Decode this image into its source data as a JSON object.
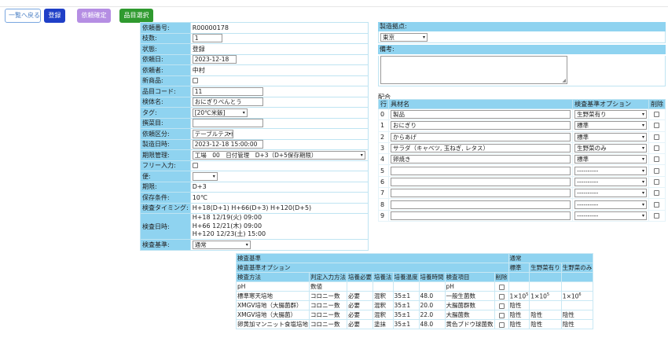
{
  "toolbar": {
    "back_label": "一覧へ戻る",
    "register_label": "登録",
    "confirm_label": "依頼確定",
    "select_label": "品目選択"
  },
  "form": {
    "request_no_label": "依頼番号:",
    "request_no": "R00000178",
    "count_label": "枝数:",
    "count": "1",
    "status_label": "状態:",
    "status": "登録",
    "request_date_label": "依頼日:",
    "request_date": "2023-12-18",
    "requester_label": "依頼者:",
    "requester": "中村",
    "new_product_label": "新商品:",
    "item_code_label": "品目コード:",
    "item_code": "11",
    "sample_name_label": "検体名:",
    "sample_name": "おにぎりべんとう",
    "tag_label": "タグ:",
    "tag": "[20℃米飯]",
    "note_label": "撰菜目:",
    "category_label": "依頼区分:",
    "category": "テーブルテスト",
    "mfg_datetime_label": "製造日時:",
    "mfg_datetime": "2023-12-18 15:00:00",
    "deadline_label": "期限管理:",
    "deadline": "工場　00　日付管理　D+3（D+5保存期限）",
    "free_input_label": "フリー入力:",
    "convenience_label": "便:",
    "period_label": "期限:",
    "period": "D+3",
    "storage_label": "保存条件:",
    "storage": "10℃",
    "timing_label": "検査タイミング:",
    "timing": "H+18(D+1) H+66(D+3) H+120(D+5)",
    "inspect_datetime_label": "検査日時:",
    "inspect_datetimes": [
      "H+18 12/19(火) 09:00",
      "H+66 12/21(木) 09:00",
      "H+120 12/23(土) 15:00"
    ],
    "standard_label": "検査基準:",
    "standard": "通常"
  },
  "site": {
    "label": "製造拠点:",
    "value": "東京"
  },
  "remarks": {
    "label": "備考:"
  },
  "haigo": {
    "title": "配合",
    "headers": [
      "行",
      "具材名",
      "検査基準オプション",
      "削除"
    ],
    "rows": [
      {
        "idx": "0",
        "name": "製品",
        "option": "生野菜有り"
      },
      {
        "idx": "1",
        "name": "おにぎり",
        "option": "標準"
      },
      {
        "idx": "2",
        "name": "からあげ",
        "option": "標準"
      },
      {
        "idx": "3",
        "name": "サラダ（キャベツ, 玉ねぎ, レタス）",
        "option": "生野菜のみ"
      },
      {
        "idx": "4",
        "name": "卵焼き",
        "option": "標準"
      },
      {
        "idx": "5",
        "name": "",
        "option": "----------"
      },
      {
        "idx": "6",
        "name": "",
        "option": "----------"
      },
      {
        "idx": "7",
        "name": "",
        "option": "----------"
      },
      {
        "idx": "8",
        "name": "",
        "option": "----------"
      },
      {
        "idx": "9",
        "name": "",
        "option": "----------"
      }
    ]
  },
  "inspection": {
    "standard_label": "検査基準",
    "standard_value": "通常",
    "option_label": "検査基準オプション",
    "opt_cols": [
      "標準",
      "生野菜有り",
      "生野菜のみ"
    ],
    "headers": [
      "検査方法",
      "判定入力方法",
      "培養必要",
      "培養法",
      "培養温度",
      "培養時間",
      "検査項目",
      "削除"
    ],
    "rows": [
      {
        "method": "pH",
        "input": "数値",
        "need": "",
        "cult": "",
        "temp": "",
        "time": "",
        "item": "pH",
        "v1": "",
        "v2": "",
        "v3": ""
      },
      {
        "method": "標準寒天培地",
        "input": "コロニー数",
        "need": "必要",
        "cult": "混釈",
        "temp": "35±1",
        "time": "48.0",
        "item": "一般生菌数",
        "v1": "1×10",
        "v1e": "5",
        "v2": "1×10",
        "v2e": "5",
        "v3": "1×10",
        "v3e": "6"
      },
      {
        "method": "XMGV培地（大腸菌群）",
        "input": "コロニー数",
        "need": "必要",
        "cult": "混釈",
        "temp": "35±1",
        "time": "20.0",
        "item": "大腸菌群数",
        "v1": "陰性",
        "v2": "",
        "v3": ""
      },
      {
        "method": "XMGV培地（大腸菌）",
        "input": "コロニー数",
        "need": "必要",
        "cult": "混釈",
        "temp": "35±1",
        "time": "22.0",
        "item": "大腸菌数",
        "v1": "陰性",
        "v2": "陰性",
        "v3": "陰性"
      },
      {
        "method": "卵黄加マンニット食塩培地",
        "input": "コロニー数",
        "need": "必要",
        "cult": "塗抹",
        "temp": "35±1",
        "time": "48.0",
        "item": "黄色ブドウ球菌数",
        "v1": "陰性",
        "v2": "陰性",
        "v3": "陰性"
      }
    ]
  }
}
